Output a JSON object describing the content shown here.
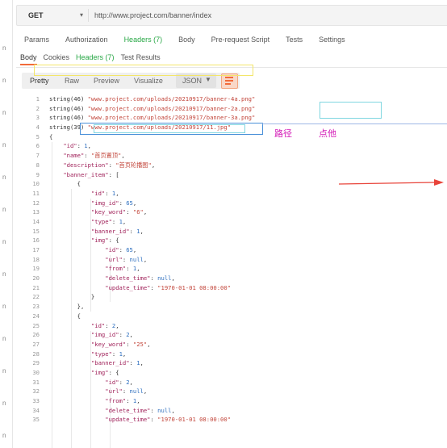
{
  "request": {
    "method": "GET",
    "url": "http://www.project.com/banner/index"
  },
  "request_tabs": [
    "Params",
    "Authorization",
    "Headers (7)",
    "Body",
    "Pre-request Script",
    "Tests",
    "Settings"
  ],
  "response_tabs": {
    "body": "Body",
    "cookies": "Cookies",
    "headers": "Headers (7)",
    "tests": "Test Results"
  },
  "view_toolbar": {
    "pretty": "Pretty",
    "raw": "Raw",
    "preview": "Preview",
    "visualize": "Visualize",
    "format": "JSON"
  },
  "annotations": {
    "path": "路径",
    "click": "点他"
  },
  "code_lines": [
    {
      "n": "1",
      "t": "string(46) \"www.project.com/uploads/20210917/banner-4a.png\""
    },
    {
      "n": "2",
      "t": "string(46) \"www.project.com/uploads/20210917/banner-2a.png\""
    },
    {
      "n": "3",
      "t": "string(46) \"www.project.com/uploads/20210917/banner-3a.png\""
    },
    {
      "n": "4",
      "t": "string(39) \"www.project.com/uploads/20210917/11.jpg\""
    },
    {
      "n": "5",
      "t": "{"
    },
    {
      "n": "6",
      "t": "    \"id\": 1,"
    },
    {
      "n": "7",
      "t": "    \"name\": \"首页置顶\","
    },
    {
      "n": "8",
      "t": "    \"description\": \"首页轮播图\","
    },
    {
      "n": "9",
      "t": "    \"banner_item\": ["
    },
    {
      "n": "10",
      "t": "        {"
    },
    {
      "n": "11",
      "t": "            \"id\": 1,"
    },
    {
      "n": "12",
      "t": "            \"img_id\": 65,"
    },
    {
      "n": "13",
      "t": "            \"key_word\": \"6\","
    },
    {
      "n": "14",
      "t": "            \"type\": 1,"
    },
    {
      "n": "15",
      "t": "            \"banner_id\": 1,"
    },
    {
      "n": "16",
      "t": "            \"img\": {"
    },
    {
      "n": "17",
      "t": "                \"id\": 65,"
    },
    {
      "n": "18",
      "t": "                \"url\": null,"
    },
    {
      "n": "19",
      "t": "                \"from\": 1,"
    },
    {
      "n": "20",
      "t": "                \"delete_time\": null,"
    },
    {
      "n": "21",
      "t": "                \"update_time\": \"1970-01-01 08:00:00\""
    },
    {
      "n": "22",
      "t": "            }"
    },
    {
      "n": "23",
      "t": "        },"
    },
    {
      "n": "24",
      "t": "        {"
    },
    {
      "n": "25",
      "t": "            \"id\": 2,"
    },
    {
      "n": "26",
      "t": "            \"img_id\": 2,"
    },
    {
      "n": "27",
      "t": "            \"key_word\": \"25\","
    },
    {
      "n": "28",
      "t": "            \"type\": 1,"
    },
    {
      "n": "29",
      "t": "            \"banner_id\": 1,"
    },
    {
      "n": "30",
      "t": "            \"img\": {"
    },
    {
      "n": "31",
      "t": "                \"id\": 2,"
    },
    {
      "n": "32",
      "t": "                \"url\": null,"
    },
    {
      "n": "33",
      "t": "                \"from\": 1,"
    },
    {
      "n": "34",
      "t": "                \"delete_time\": null,"
    },
    {
      "n": "35",
      "t": "                \"update_time\": \"1970-01-01 08:00:00\""
    }
  ],
  "colors": {
    "accent": "#f26b3a",
    "annotation": "#d319b6",
    "arrow": "#e8443a",
    "json_key": "#a0225a",
    "json_string": "#c2453a",
    "json_literal": "#2e6fbf"
  }
}
